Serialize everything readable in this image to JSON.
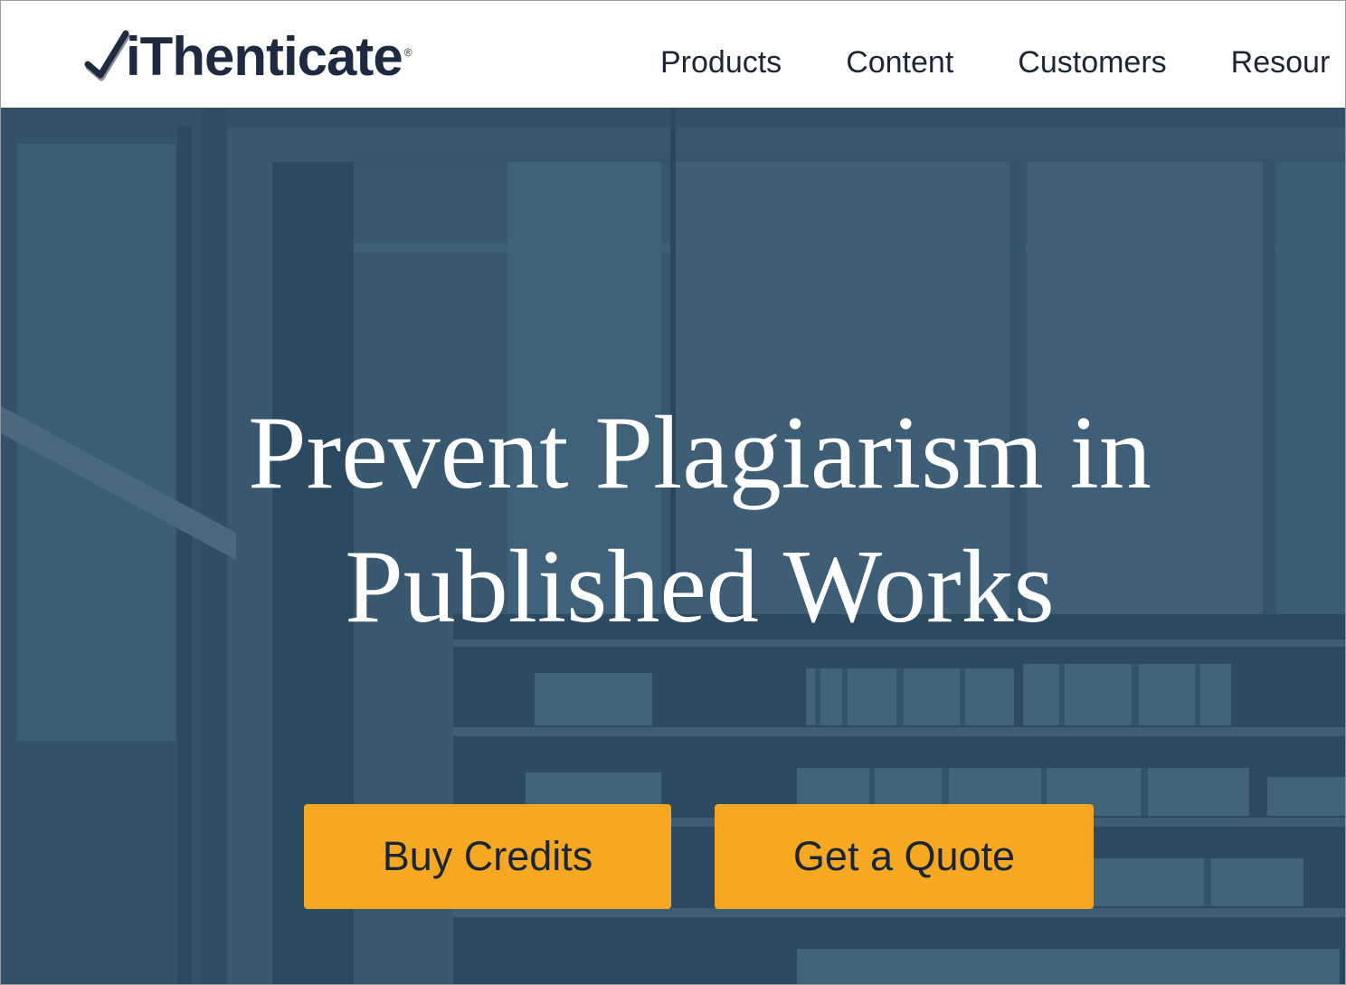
{
  "brand": {
    "name": "iThenticate",
    "registered_mark": "®",
    "text_color": "#1d2a3f",
    "check_color": "#1d2a3f",
    "check_shadow_color": "#8a8f98"
  },
  "nav": {
    "items": [
      {
        "label": "Products"
      },
      {
        "label": "Content"
      },
      {
        "label": "Customers"
      },
      {
        "label": "Resour"
      }
    ]
  },
  "hero": {
    "headline_line1": "Prevent Plagiarism in",
    "headline_line2": "Published Works",
    "overlay_color": "#3c5d75",
    "background_icon": "library-bookshelves-photo"
  },
  "buttons": {
    "buy_credits": "Buy Credits",
    "get_quote": "Get a Quote",
    "color": "#f6a823"
  }
}
